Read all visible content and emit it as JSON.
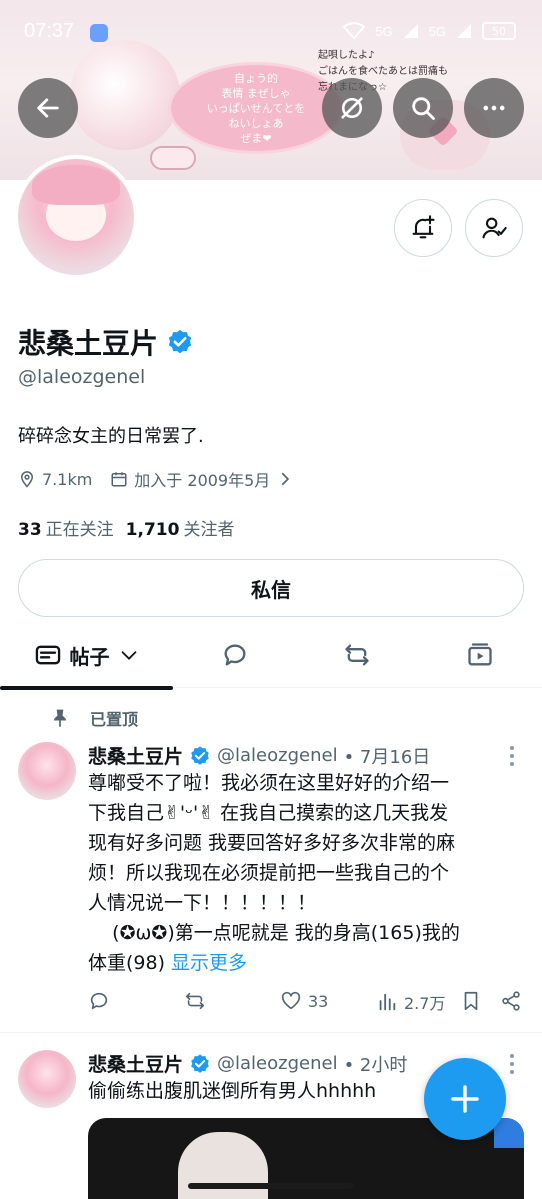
{
  "status_bar": {
    "time": "07:37",
    "signal_1": "5G",
    "signal_2": "5G",
    "battery": "50"
  },
  "banner": {
    "bubble_text": "自ょう的\n表情 まぜしゃ\nいっぱいせんてとを\nねいしょあ\nぜま❤",
    "note_text": "起唄したよ♪\nごはんを食べたあとは罰痛も\n忘れまになっ☆"
  },
  "profile": {
    "display_name": "悲桑土豆片",
    "handle": "@laleozgenel",
    "bio": "碎碎念女主的日常罢了.",
    "location": "7.1km",
    "joined": "加入于 2009年5月",
    "following_count": "33",
    "following_label": "正在关注",
    "followers_count": "1,710",
    "followers_label": "关注者",
    "dm_label": "私信"
  },
  "tabs": {
    "posts_label": "帖子"
  },
  "pinned_label": "已置顶",
  "posts": [
    {
      "name": "悲桑土豆片",
      "handle": "@laleozgenel",
      "time": "• 7月16日",
      "lines": [
        "尊嘟受不了啦！我必须在这里好好的介绍一",
        "下我自己✌'ᵕ'✌ 在我自己摸索的这几天我发",
        "现有好多问题 我要回答好多好多次非常的麻",
        "烦！所以我现在必须提前把一些我自己的个",
        "人情况说一下！！！！！！",
        "    (✪ω✪)第一点呢就是 我的身高(165)我的",
        "体重(98) "
      ],
      "show_more": "显示更多",
      "likes": "33",
      "views": "2.7万"
    },
    {
      "name": "悲桑土豆片",
      "handle": "@laleozgenel",
      "time": "• 2小时",
      "lines": [
        "偷偷练出腹肌迷倒所有男人hhhhh"
      ]
    }
  ],
  "colors": {
    "accent": "#1d9bf0",
    "text": "#0f1419",
    "secondary": "#536471",
    "border": "#cfd9de"
  }
}
